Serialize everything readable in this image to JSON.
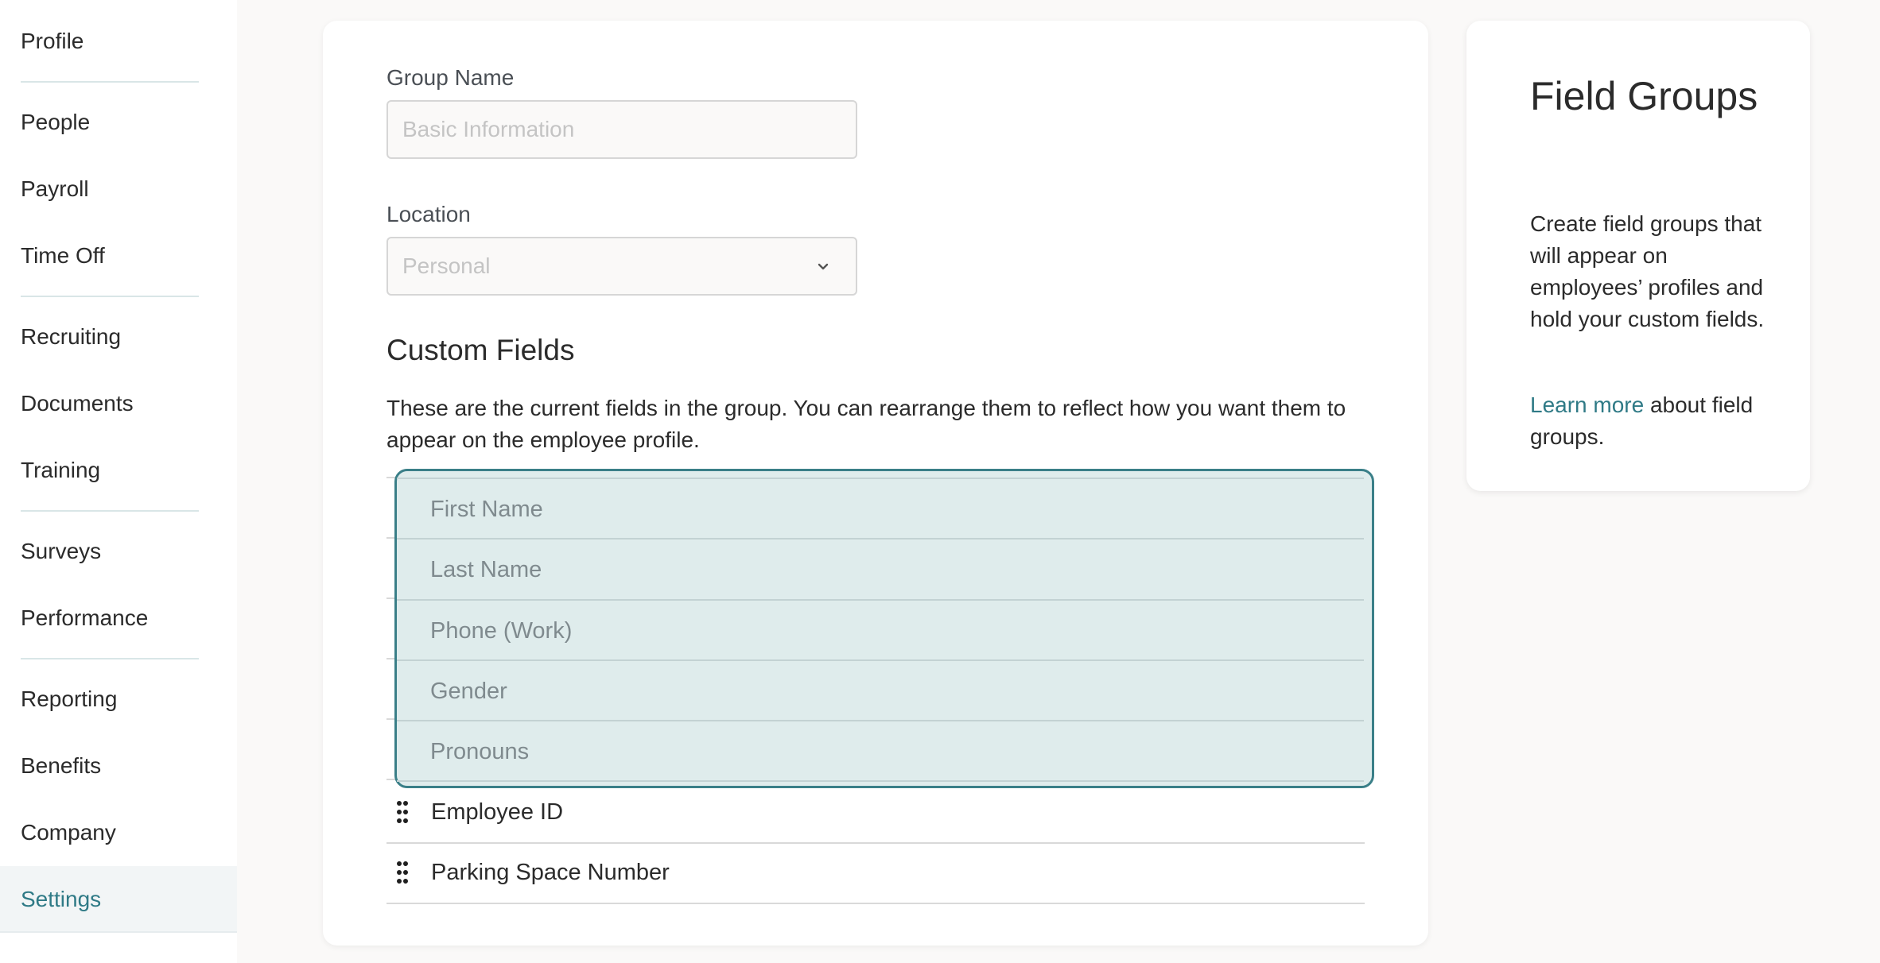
{
  "sidebar": {
    "items": [
      {
        "label": "Profile"
      },
      {
        "label": "People"
      },
      {
        "label": "Payroll"
      },
      {
        "label": "Time Off"
      },
      {
        "label": "Recruiting"
      },
      {
        "label": "Documents"
      },
      {
        "label": "Training"
      },
      {
        "label": "Surveys"
      },
      {
        "label": "Performance"
      },
      {
        "label": "Reporting"
      },
      {
        "label": "Benefits"
      },
      {
        "label": "Company"
      },
      {
        "label": "Settings"
      }
    ],
    "active": "Settings"
  },
  "form": {
    "group_name_label": "Group Name",
    "group_name_placeholder": "Basic Information",
    "location_label": "Location",
    "location_value": "Personal",
    "custom_fields_title": "Custom Fields",
    "custom_fields_desc": "These are the current fields in the group. You can rearrange them to reflect how you want them to appear on the employee profile.",
    "dragging_fields": [
      "First Name",
      "Last Name",
      "Phone (Work)",
      "Gender",
      "Pronouns"
    ],
    "fields": [
      "Employee ID",
      "Parking Space Number"
    ]
  },
  "info": {
    "title": "Field Groups",
    "body": "Create field groups that will appear on employees’ profiles and hold your custom fields.",
    "link": "Learn more",
    "link_suffix": " about field groups."
  },
  "icons": {
    "drag_handle": "drag-handle-icon",
    "dropdown": "chevron-down-icon"
  },
  "colors": {
    "accent": "#2f7a86",
    "drop_zone_bg": "#dfecec",
    "drop_zone_border": "#3a7f88"
  }
}
